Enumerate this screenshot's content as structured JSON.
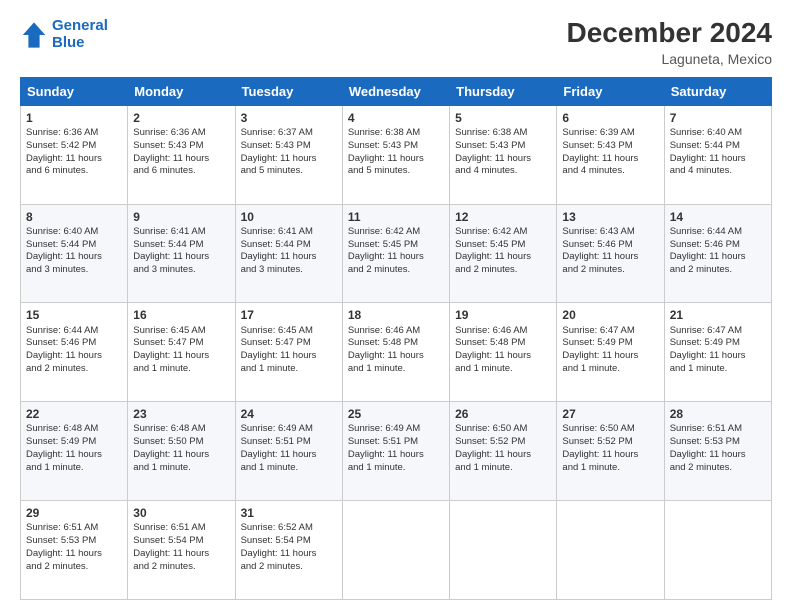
{
  "header": {
    "logo_line1": "General",
    "logo_line2": "Blue",
    "main_title": "December 2024",
    "subtitle": "Laguneta, Mexico"
  },
  "days_of_week": [
    "Sunday",
    "Monday",
    "Tuesday",
    "Wednesday",
    "Thursday",
    "Friday",
    "Saturday"
  ],
  "weeks": [
    [
      {
        "day": "1",
        "lines": [
          "Sunrise: 6:36 AM",
          "Sunset: 5:42 PM",
          "Daylight: 11 hours",
          "and 6 minutes."
        ]
      },
      {
        "day": "2",
        "lines": [
          "Sunrise: 6:36 AM",
          "Sunset: 5:43 PM",
          "Daylight: 11 hours",
          "and 6 minutes."
        ]
      },
      {
        "day": "3",
        "lines": [
          "Sunrise: 6:37 AM",
          "Sunset: 5:43 PM",
          "Daylight: 11 hours",
          "and 5 minutes."
        ]
      },
      {
        "day": "4",
        "lines": [
          "Sunrise: 6:38 AM",
          "Sunset: 5:43 PM",
          "Daylight: 11 hours",
          "and 5 minutes."
        ]
      },
      {
        "day": "5",
        "lines": [
          "Sunrise: 6:38 AM",
          "Sunset: 5:43 PM",
          "Daylight: 11 hours",
          "and 4 minutes."
        ]
      },
      {
        "day": "6",
        "lines": [
          "Sunrise: 6:39 AM",
          "Sunset: 5:43 PM",
          "Daylight: 11 hours",
          "and 4 minutes."
        ]
      },
      {
        "day": "7",
        "lines": [
          "Sunrise: 6:40 AM",
          "Sunset: 5:44 PM",
          "Daylight: 11 hours",
          "and 4 minutes."
        ]
      }
    ],
    [
      {
        "day": "8",
        "lines": [
          "Sunrise: 6:40 AM",
          "Sunset: 5:44 PM",
          "Daylight: 11 hours",
          "and 3 minutes."
        ]
      },
      {
        "day": "9",
        "lines": [
          "Sunrise: 6:41 AM",
          "Sunset: 5:44 PM",
          "Daylight: 11 hours",
          "and 3 minutes."
        ]
      },
      {
        "day": "10",
        "lines": [
          "Sunrise: 6:41 AM",
          "Sunset: 5:44 PM",
          "Daylight: 11 hours",
          "and 3 minutes."
        ]
      },
      {
        "day": "11",
        "lines": [
          "Sunrise: 6:42 AM",
          "Sunset: 5:45 PM",
          "Daylight: 11 hours",
          "and 2 minutes."
        ]
      },
      {
        "day": "12",
        "lines": [
          "Sunrise: 6:42 AM",
          "Sunset: 5:45 PM",
          "Daylight: 11 hours",
          "and 2 minutes."
        ]
      },
      {
        "day": "13",
        "lines": [
          "Sunrise: 6:43 AM",
          "Sunset: 5:46 PM",
          "Daylight: 11 hours",
          "and 2 minutes."
        ]
      },
      {
        "day": "14",
        "lines": [
          "Sunrise: 6:44 AM",
          "Sunset: 5:46 PM",
          "Daylight: 11 hours",
          "and 2 minutes."
        ]
      }
    ],
    [
      {
        "day": "15",
        "lines": [
          "Sunrise: 6:44 AM",
          "Sunset: 5:46 PM",
          "Daylight: 11 hours",
          "and 2 minutes."
        ]
      },
      {
        "day": "16",
        "lines": [
          "Sunrise: 6:45 AM",
          "Sunset: 5:47 PM",
          "Daylight: 11 hours",
          "and 1 minute."
        ]
      },
      {
        "day": "17",
        "lines": [
          "Sunrise: 6:45 AM",
          "Sunset: 5:47 PM",
          "Daylight: 11 hours",
          "and 1 minute."
        ]
      },
      {
        "day": "18",
        "lines": [
          "Sunrise: 6:46 AM",
          "Sunset: 5:48 PM",
          "Daylight: 11 hours",
          "and 1 minute."
        ]
      },
      {
        "day": "19",
        "lines": [
          "Sunrise: 6:46 AM",
          "Sunset: 5:48 PM",
          "Daylight: 11 hours",
          "and 1 minute."
        ]
      },
      {
        "day": "20",
        "lines": [
          "Sunrise: 6:47 AM",
          "Sunset: 5:49 PM",
          "Daylight: 11 hours",
          "and 1 minute."
        ]
      },
      {
        "day": "21",
        "lines": [
          "Sunrise: 6:47 AM",
          "Sunset: 5:49 PM",
          "Daylight: 11 hours",
          "and 1 minute."
        ]
      }
    ],
    [
      {
        "day": "22",
        "lines": [
          "Sunrise: 6:48 AM",
          "Sunset: 5:49 PM",
          "Daylight: 11 hours",
          "and 1 minute."
        ]
      },
      {
        "day": "23",
        "lines": [
          "Sunrise: 6:48 AM",
          "Sunset: 5:50 PM",
          "Daylight: 11 hours",
          "and 1 minute."
        ]
      },
      {
        "day": "24",
        "lines": [
          "Sunrise: 6:49 AM",
          "Sunset: 5:51 PM",
          "Daylight: 11 hours",
          "and 1 minute."
        ]
      },
      {
        "day": "25",
        "lines": [
          "Sunrise: 6:49 AM",
          "Sunset: 5:51 PM",
          "Daylight: 11 hours",
          "and 1 minute."
        ]
      },
      {
        "day": "26",
        "lines": [
          "Sunrise: 6:50 AM",
          "Sunset: 5:52 PM",
          "Daylight: 11 hours",
          "and 1 minute."
        ]
      },
      {
        "day": "27",
        "lines": [
          "Sunrise: 6:50 AM",
          "Sunset: 5:52 PM",
          "Daylight: 11 hours",
          "and 1 minute."
        ]
      },
      {
        "day": "28",
        "lines": [
          "Sunrise: 6:51 AM",
          "Sunset: 5:53 PM",
          "Daylight: 11 hours",
          "and 2 minutes."
        ]
      }
    ],
    [
      {
        "day": "29",
        "lines": [
          "Sunrise: 6:51 AM",
          "Sunset: 5:53 PM",
          "Daylight: 11 hours",
          "and 2 minutes."
        ]
      },
      {
        "day": "30",
        "lines": [
          "Sunrise: 6:51 AM",
          "Sunset: 5:54 PM",
          "Daylight: 11 hours",
          "and 2 minutes."
        ]
      },
      {
        "day": "31",
        "lines": [
          "Sunrise: 6:52 AM",
          "Sunset: 5:54 PM",
          "Daylight: 11 hours",
          "and 2 minutes."
        ]
      },
      null,
      null,
      null,
      null
    ]
  ]
}
